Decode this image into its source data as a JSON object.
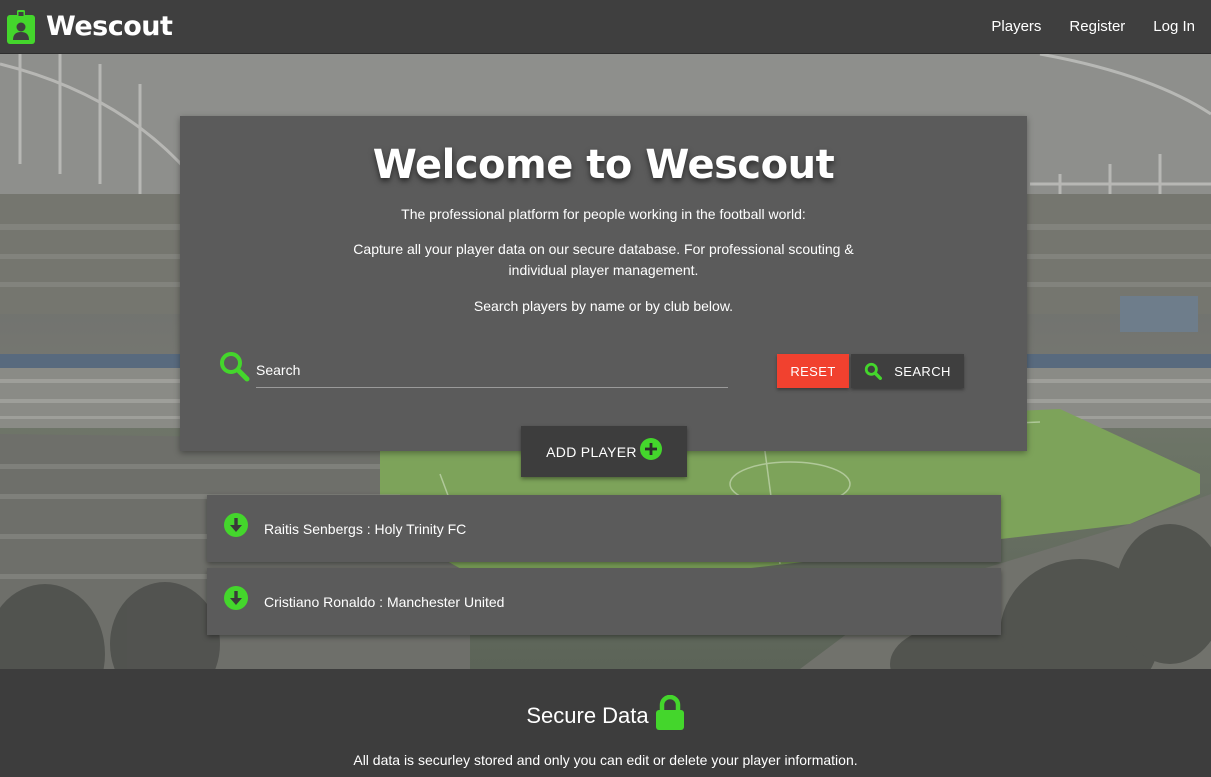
{
  "navbar": {
    "brand": "Wescout",
    "links": [
      "Players",
      "Register",
      "Log In"
    ]
  },
  "welcome": {
    "title": "Welcome to Wescout",
    "intro": "The professional platform for people working in the football world:",
    "capture": "Capture all your player data on our secure database. For professional scouting & individual player management.",
    "search_hint": "Search players by name or by club below."
  },
  "search": {
    "placeholder": "Search",
    "reset_label": "RESET",
    "search_label": "SEARCH"
  },
  "add_player": {
    "label": "ADD PLAYER"
  },
  "players": [
    {
      "label": "Raitis Senbergs : Holy Trinity FC"
    },
    {
      "label": "Cristiano Ronaldo : Manchester United"
    }
  ],
  "secure": {
    "title": "Secure Data",
    "text": "All data is securley stored and only you can edit or delete your player information."
  },
  "colors": {
    "accent": "#44d62c",
    "reset": "#f1412f",
    "card": "#5b5b5b",
    "dark": "#3d3d3d"
  },
  "icons": {
    "brand": "id-badge-icon",
    "search": "search-icon",
    "add": "plus-circle-icon",
    "player_row": "arrow-down-circle-icon",
    "secure": "lock-icon"
  }
}
